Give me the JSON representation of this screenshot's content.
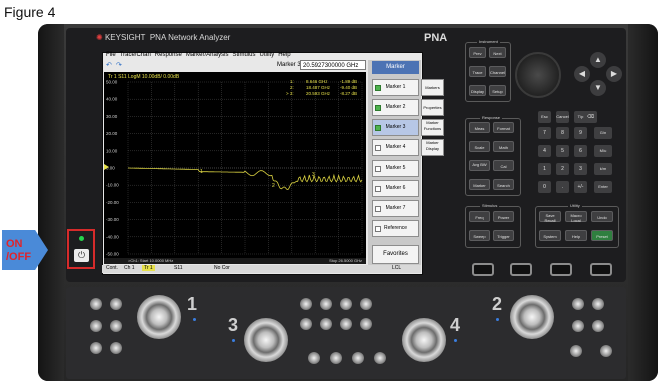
{
  "figure_title": "Figure 4",
  "instrument": {
    "brand_prefix": "KEYSIGHT",
    "brand_product": "PNA Network Analyzer",
    "model": "PNA"
  },
  "menu": [
    "File",
    "Trace/Chan",
    "Response",
    "Marker/Analysis",
    "Stimulus",
    "Utility",
    "Help"
  ],
  "toolbar": {
    "marker_label": "Marker 3",
    "marker_value": "20.5927300000 GHz"
  },
  "trace": {
    "header": "Tr 1  S11 LogM 10.00dB/ 0.00dB",
    "y_ticks": [
      "50.00",
      "40.00",
      "30.00",
      "20.00",
      "10.00",
      "0.00",
      "-10.00",
      "-20.00",
      "-30.00",
      "-40.00",
      "-50.00"
    ],
    "marker_readout": [
      {
        "id": "1:",
        "freq": "8.646 GHz",
        "val": "-1.89 dB"
      },
      {
        "id": "2:",
        "freq": "18.487 GHz",
        "val": "-9.40 dB"
      },
      {
        "id": "> 3:",
        "freq": "20.593 GHz",
        "val": "-8.27 dB"
      }
    ],
    "start": ">Ch1:  Start  10.0000 MHz",
    "stop": "Stop  26.5000 GHz"
  },
  "statusbar": {
    "cont": "Cont.",
    "ch": "Ch 1",
    "tr": "Tr 1",
    "param": "S11",
    "cor": "No Cor",
    "lcl": "LCL"
  },
  "softkeys": {
    "title": "Marker",
    "items": [
      {
        "label": "Marker 1",
        "checked": true
      },
      {
        "label": "Marker 2",
        "checked": true
      },
      {
        "label": "Marker 3",
        "checked": true
      },
      {
        "label": "Marker 4",
        "checked": false
      },
      {
        "label": "Marker 5",
        "checked": false
      },
      {
        "label": "Marker 6",
        "checked": false
      },
      {
        "label": "Marker 7",
        "checked": false
      },
      {
        "label": "Reference",
        "checked": false
      }
    ],
    "favorites": "Favorites",
    "right_tabs": [
      "Markers",
      "Properties",
      "Marker Functions",
      "Marker Display"
    ]
  },
  "hardkeys": {
    "instrument_label": "Instrument",
    "instrument": [
      "Prev",
      "Next",
      "Trace",
      "Channel",
      "Display",
      "Setup"
    ],
    "response_label": "Response",
    "response": [
      "Meas",
      "Format",
      "Scale",
      "Math",
      "Avg BW",
      "Cal",
      "Marker",
      "Search"
    ],
    "numpad": [
      "7",
      "8",
      "9",
      "4",
      "5",
      "6",
      "1",
      "2",
      "3",
      "0",
      ".",
      "+/-"
    ],
    "units": [
      "G/n",
      "M/u",
      "k/m",
      "Enter"
    ],
    "top_keys": [
      "Esc",
      "Cancel",
      "T/p"
    ],
    "stimulus_label": "Stimulus",
    "stimulus": [
      "Freq",
      "Power",
      "Sweep",
      "Trigger"
    ],
    "utility_label": "Utility",
    "utility": [
      "Save Recall",
      "Macro Local",
      "Undo",
      "System",
      "Help",
      "Preset"
    ]
  },
  "annotation": {
    "onoff": "ON /OFF"
  },
  "ports": {
    "p1": "1",
    "p2": "2",
    "p3": "3",
    "p4": "4"
  }
}
